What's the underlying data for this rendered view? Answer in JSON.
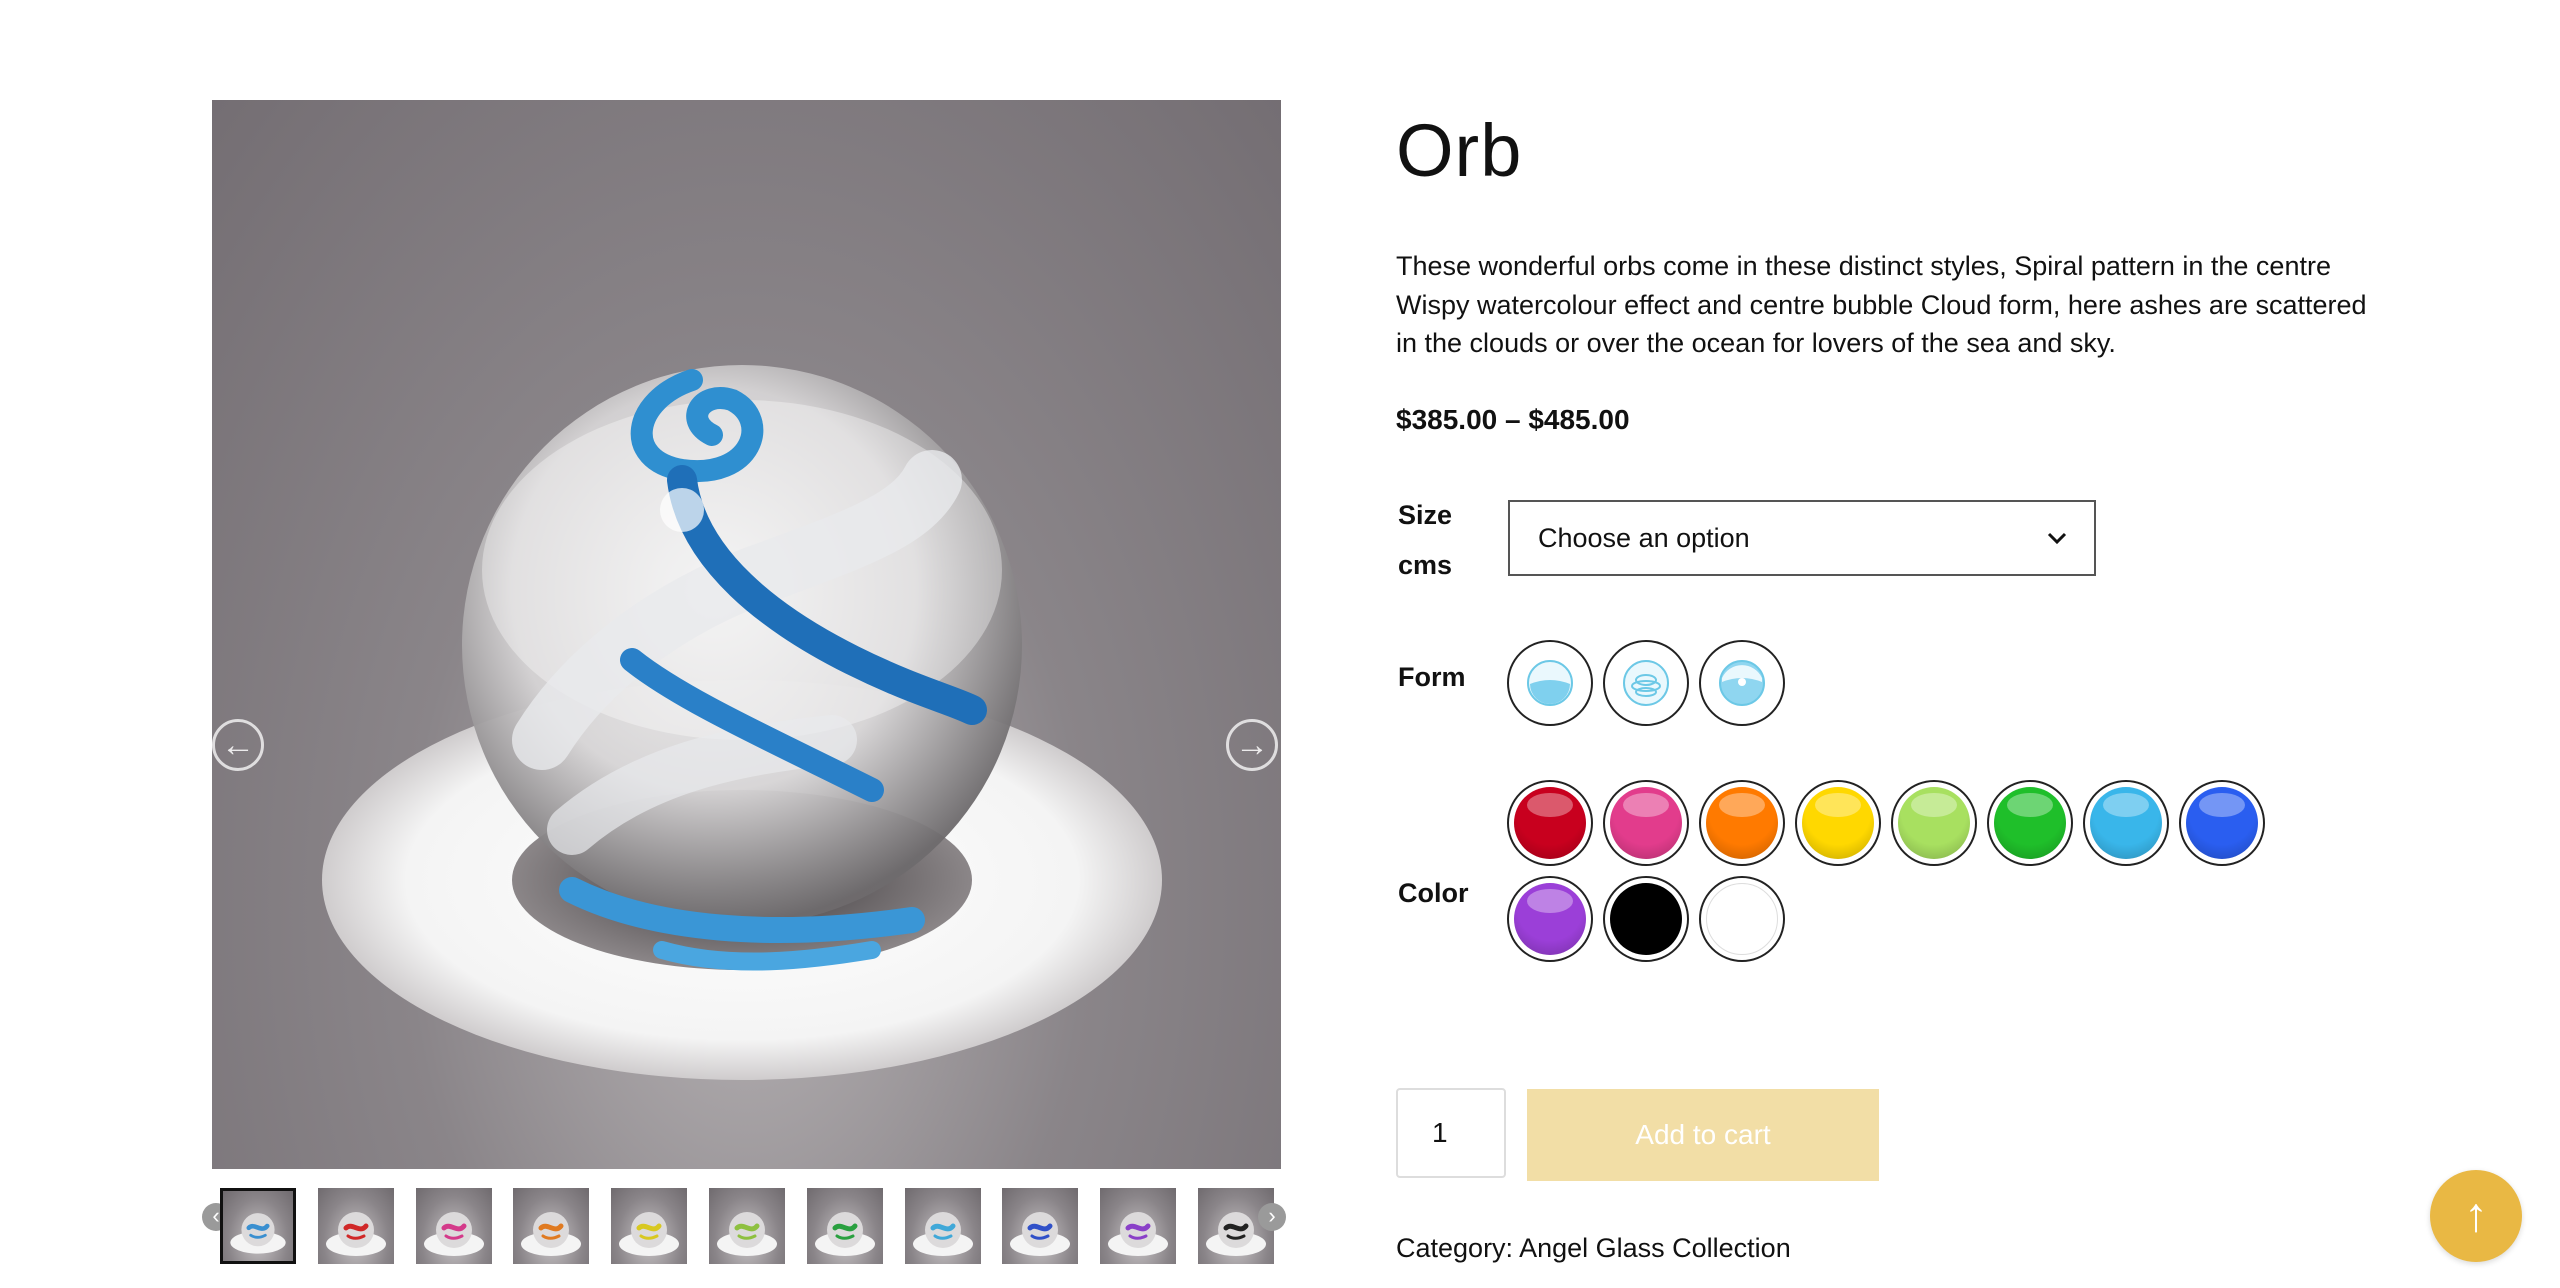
{
  "product": {
    "title": "Orb",
    "description": "These wonderful orbs come in these distinct styles, Spiral pattern in the centre Wispy watercolour effect and centre bubble Cloud form, here ashes are scattered in the clouds or over the ocean for lovers of the sea and sky.",
    "price_range": "$385.00 – $485.00"
  },
  "gallery": {
    "prev_icon": "arrow-left-icon",
    "next_icon": "arrow-right-icon",
    "thumbnails": [
      {
        "color": "#3a8fd0",
        "active": true
      },
      {
        "color": "#d02828",
        "active": false
      },
      {
        "color": "#d43a8a",
        "active": false
      },
      {
        "color": "#e07a20",
        "active": false
      },
      {
        "color": "#d8c820",
        "active": false
      },
      {
        "color": "#8ec040",
        "active": false
      },
      {
        "color": "#2aa040",
        "active": false
      },
      {
        "color": "#40a8d8",
        "active": false
      },
      {
        "color": "#3050c8",
        "active": false
      },
      {
        "color": "#8a40c8",
        "active": false
      },
      {
        "color": "#222222",
        "active": false
      }
    ]
  },
  "attributes": {
    "size": {
      "label": "Size cms",
      "selected": "Choose an option"
    },
    "form": {
      "label": "Form",
      "options": [
        "Cloud",
        "Spiral",
        "Bubble"
      ]
    },
    "color": {
      "label": "Color",
      "swatches": [
        {
          "name": "Red",
          "hex": "#c8001e"
        },
        {
          "name": "Pink",
          "hex": "#e23c8c"
        },
        {
          "name": "Orange",
          "hex": "#ff7a00"
        },
        {
          "name": "Yellow",
          "hex": "#ffd800"
        },
        {
          "name": "Lime",
          "hex": "#a8e060"
        },
        {
          "name": "Green",
          "hex": "#1fbf2a"
        },
        {
          "name": "Sky",
          "hex": "#39b6ea"
        },
        {
          "name": "Blue",
          "hex": "#2a5ef0"
        },
        {
          "name": "Purple",
          "hex": "#9b3fd8"
        },
        {
          "name": "Black",
          "hex": "#000000"
        },
        {
          "name": "White",
          "hex": "#ffffff"
        }
      ]
    }
  },
  "cart": {
    "quantity": "1",
    "button_label": "Add to cart"
  },
  "meta": {
    "category_label": "Category:",
    "category_value": "Angel Glass Collection"
  },
  "scroll_top_icon": "arrow-up-icon",
  "colors": {
    "accent": "#e9b844",
    "button_disabled": "#f2dea6"
  }
}
